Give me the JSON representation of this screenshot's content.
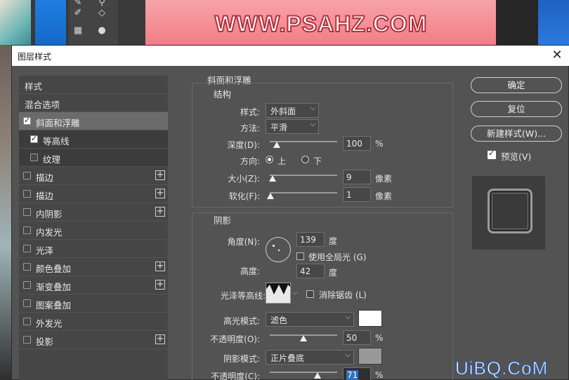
{
  "background": {
    "watermark_text": "WWW.PSAHZ.COM",
    "bottom_watermark": "UiBQ.CoM"
  },
  "dialog": {
    "title": "图层样式",
    "close_glyph": "✕"
  },
  "style_list": [
    {
      "label": "样式",
      "checkbox": "none",
      "state": "normal",
      "plus": false
    },
    {
      "label": "混合选项",
      "checkbox": "none",
      "state": "normal",
      "plus": false
    },
    {
      "label": "斜面和浮雕",
      "checkbox": "checked",
      "state": "selected",
      "plus": false
    },
    {
      "label": "等高线",
      "checkbox": "checked",
      "state": "sub",
      "plus": false
    },
    {
      "label": "纹理",
      "checkbox": "unchecked",
      "state": "sub",
      "plus": false
    },
    {
      "label": "描边",
      "checkbox": "unchecked",
      "state": "normal",
      "plus": true
    },
    {
      "label": "描边",
      "checkbox": "unchecked",
      "state": "normal",
      "plus": true
    },
    {
      "label": "内阴影",
      "checkbox": "unchecked",
      "state": "normal",
      "plus": true
    },
    {
      "label": "内发光",
      "checkbox": "unchecked",
      "state": "normal",
      "plus": false
    },
    {
      "label": "光泽",
      "checkbox": "unchecked",
      "state": "normal",
      "plus": false
    },
    {
      "label": "颜色叠加",
      "checkbox": "unchecked",
      "state": "normal",
      "plus": true
    },
    {
      "label": "渐变叠加",
      "checkbox": "unchecked",
      "state": "normal",
      "plus": true
    },
    {
      "label": "图案叠加",
      "checkbox": "unchecked",
      "state": "normal",
      "plus": false
    },
    {
      "label": "外发光",
      "checkbox": "unchecked",
      "state": "normal",
      "plus": false
    },
    {
      "label": "投影",
      "checkbox": "unchecked",
      "state": "normal",
      "plus": true
    }
  ],
  "bevel": {
    "section_title": "斜面和浮雕",
    "structure_title": "结构",
    "style_label": "样式:",
    "style_value": "外斜面",
    "technique_label": "方法:",
    "technique_value": "平滑",
    "depth_label": "深度(D):",
    "depth_value": "100",
    "depth_unit": "%",
    "depth_slider_fraction": 0.1,
    "direction_label": "方向:",
    "direction_up": "上",
    "direction_down": "下",
    "direction_selected": "up",
    "size_label": "大小(Z):",
    "size_value": "9",
    "size_unit": "像素",
    "size_slider_fraction": 0.04,
    "soften_label": "软化(F):",
    "soften_value": "1",
    "soften_unit": "像素",
    "soften_slider_fraction": 0.01
  },
  "shading": {
    "title": "阴影",
    "angle_label": "角度(N):",
    "angle_value": "139",
    "angle_unit": "度",
    "global_light_label": "使用全局光 (G)",
    "altitude_label": "高度:",
    "altitude_value": "42",
    "altitude_unit": "度",
    "gloss_contour_label": "光泽等高线:",
    "antialias_label": "消除锯齿 (L)",
    "highlight_mode_label": "高光模式:",
    "highlight_mode_value": "滤色",
    "highlight_color": "#ffffff",
    "highlight_opacity_label": "不透明度(O):",
    "highlight_opacity_value": "50",
    "highlight_opacity_unit": "%",
    "highlight_opacity_fraction": 0.5,
    "shadow_mode_label": "阴影模式:",
    "shadow_mode_value": "正片叠底",
    "shadow_color": "#999999",
    "shadow_opacity_label": "不透明度(C):",
    "shadow_opacity_value": "71",
    "shadow_opacity_unit": "%",
    "shadow_opacity_fraction": 0.71
  },
  "buttons": {
    "ok": "确定",
    "reset": "复位",
    "new_style": "新建样式(W)...",
    "preview_label": "预览(V)"
  }
}
